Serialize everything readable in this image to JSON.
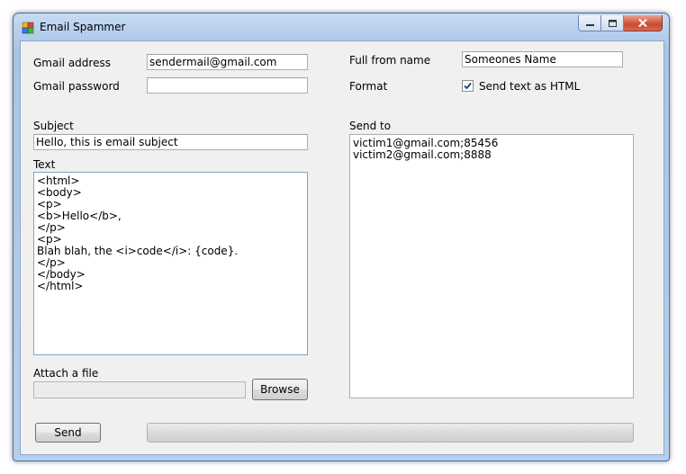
{
  "window": {
    "title": "Email Spammer",
    "icon": "app-icon",
    "controls": {
      "minimize": "minimize-icon",
      "maximize": "maximize-icon",
      "close": "close-icon"
    }
  },
  "left": {
    "gmail_address_label": "Gmail address",
    "gmail_address_value": "sendermail@gmail.com",
    "gmail_password_label": "Gmail password",
    "gmail_password_value": "",
    "subject_label": "Subject",
    "subject_value": "Hello, this is email subject",
    "text_label": "Text",
    "text_lines": [
      "<html>",
      "<body>",
      "<p>",
      "<b>Hello</b>,",
      "</p>",
      "<p>",
      "Blah blah, the <i>code</i>: {code}.",
      "</p>",
      "</body>",
      "</html>"
    ],
    "attach_label": "Attach a file",
    "attach_value": "",
    "browse_label": "Browse"
  },
  "right": {
    "full_from_name_label": "Full from name",
    "full_from_name_value": "Someones Name",
    "format_label": "Format",
    "send_html_label": "Send text as HTML",
    "send_html_checked": true,
    "send_to_label": "Send to",
    "send_to_lines": [
      "victim1@gmail.com;85456",
      "victim2@gmail.com;8888"
    ]
  },
  "footer": {
    "send_label": "Send",
    "progress": 0
  }
}
